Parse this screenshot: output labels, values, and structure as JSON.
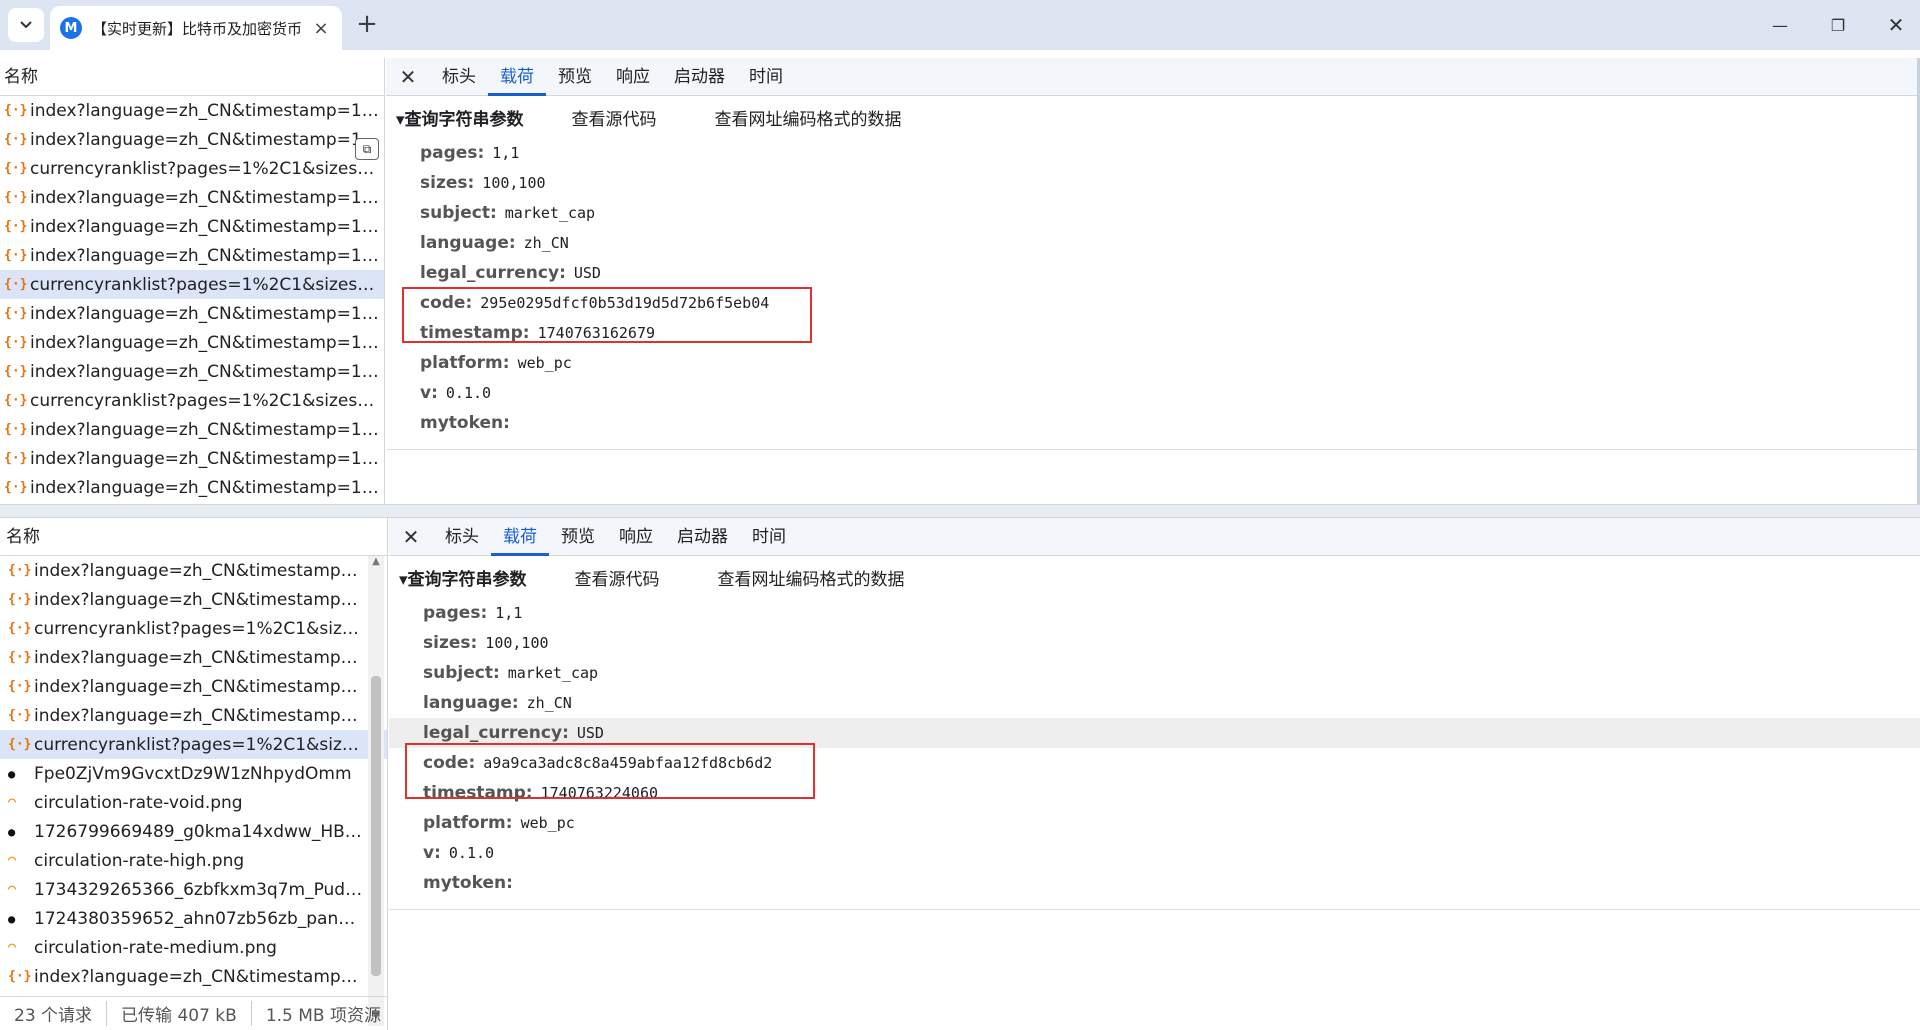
{
  "browser": {
    "tab_title": "【实时更新】比特币及加密货币",
    "tab_close": "×",
    "new_tab": "+",
    "favicon_letter": "M"
  },
  "window_controls": {
    "minimize": "—",
    "maximize": "❐",
    "close": "✕"
  },
  "top": {
    "list_header": "名称",
    "rows": [
      {
        "text": "index?language=zh_CN&timestamp=1740...",
        "icon": "{·}"
      },
      {
        "text": "index?language=zh_CN&timestamp=1...",
        "icon": "{·}"
      },
      {
        "text": "currencyranklist?pages=1%2C1&sizes=10...",
        "icon": "{·}"
      },
      {
        "text": "index?language=zh_CN&timestamp=1740...",
        "icon": "{·}"
      },
      {
        "text": "index?language=zh_CN&timestamp=1740...",
        "icon": "{·}"
      },
      {
        "text": "index?language=zh_CN&timestamp=1740...",
        "icon": "{·}"
      },
      {
        "text": "currencyranklist?pages=1%2C1&sizes=10...",
        "icon": "{·}"
      },
      {
        "text": "index?language=zh_CN&timestamp=1740...",
        "icon": "{·}"
      },
      {
        "text": "index?language=zh_CN&timestamp=1740...",
        "icon": "{·}"
      },
      {
        "text": "index?language=zh_CN&timestamp=1740...",
        "icon": "{·}"
      },
      {
        "text": "currencyranklist?pages=1%2C1&sizes=10...",
        "icon": "{·}"
      },
      {
        "text": "index?language=zh_CN&timestamp=1740...",
        "icon": "{·}"
      },
      {
        "text": "index?language=zh_CN&timestamp=1740...",
        "icon": "{·}"
      },
      {
        "text": "index?language=zh_CN&timestamp=1740...",
        "icon": "{·}"
      }
    ],
    "copy_icon": "⧉",
    "detail_tabs": {
      "close": "✕",
      "headers": "标头",
      "payload": "载荷",
      "preview": "预览",
      "response": "响应",
      "initiator": "启动器",
      "timing": "时间"
    },
    "qs": {
      "title": "▾查询字符串参数",
      "view_source": "查看源代码",
      "view_url_encoded": "查看网址编码格式的数据"
    },
    "params": [
      {
        "key": "pages:",
        "value": "1,1"
      },
      {
        "key": "sizes:",
        "value": "100,100"
      },
      {
        "key": "subject:",
        "value": "market_cap"
      },
      {
        "key": "language:",
        "value": "zh_CN"
      },
      {
        "key": "legal_currency:",
        "value": "USD"
      },
      {
        "key": "code:",
        "value": "295e0295dfcf0b53d19d5d72b6f5eb04"
      },
      {
        "key": "timestamp:",
        "value": "1740763162679"
      },
      {
        "key": "platform:",
        "value": "web_pc"
      },
      {
        "key": "v:",
        "value": "0.1.0"
      },
      {
        "key": "mytoken:",
        "value": ""
      }
    ]
  },
  "bottom": {
    "list_header": "名称",
    "rows": [
      {
        "text": "index?language=zh_CN&timestamp=1...",
        "icon": "{·}"
      },
      {
        "text": "index?language=zh_CN&timestamp=1...",
        "icon": "{·}"
      },
      {
        "text": "currencyranklist?pages=1%2C1&sizes=...",
        "icon": "{·}"
      },
      {
        "text": "index?language=zh_CN&timestamp=1...",
        "icon": "{·}"
      },
      {
        "text": "index?language=zh_CN&timestamp=1...",
        "icon": "{·}"
      },
      {
        "text": "index?language=zh_CN&timestamp=1...",
        "icon": "{·}"
      },
      {
        "text": "currencyranklist?pages=1%2C1&sizes=...",
        "icon": "{·}"
      },
      {
        "text": "Fpe0ZjVm9GvcxtDz9W1zNhpydOmm",
        "icon": "●"
      },
      {
        "text": "circulation-rate-void.png",
        "icon": "◠"
      },
      {
        "text": "1726799669489_g0kma14xdww_HBAR....",
        "icon": "●"
      },
      {
        "text": "circulation-rate-high.png",
        "icon": "◠"
      },
      {
        "text": "1734329265366_6zbfkxm3q7m_Pudgy...",
        "icon": "◠"
      },
      {
        "text": "1724380359652_ahn07zb56zb_pancake...",
        "icon": "●"
      },
      {
        "text": "circulation-rate-medium.png",
        "icon": "◠"
      },
      {
        "text": "index?language=zh_CN&timestamp=1...",
        "icon": "{·}"
      }
    ],
    "status": {
      "requests": "23 个请求",
      "transferred": "已传输 407 kB",
      "resources": "1.5 MB 项资源"
    },
    "scroll_up": "▲",
    "scroll_down": "▼",
    "detail_tabs": {
      "close": "✕",
      "headers": "标头",
      "payload": "载荷",
      "preview": "预览",
      "response": "响应",
      "initiator": "启动器",
      "timing": "时间"
    },
    "qs": {
      "title": "▾查询字符串参数",
      "view_source": "查看源代码",
      "view_url_encoded": "查看网址编码格式的数据"
    },
    "params": [
      {
        "key": "pages:",
        "value": "1,1"
      },
      {
        "key": "sizes:",
        "value": "100,100"
      },
      {
        "key": "subject:",
        "value": "market_cap"
      },
      {
        "key": "language:",
        "value": "zh_CN"
      },
      {
        "key": "legal_currency:",
        "value": "USD"
      },
      {
        "key": "code:",
        "value": "a9a9ca3adc8c8a459abfaa12fd8cb6d2"
      },
      {
        "key": "timestamp:",
        "value": "1740763224060"
      },
      {
        "key": "platform:",
        "value": "web_pc"
      },
      {
        "key": "v:",
        "value": "0.1.0"
      },
      {
        "key": "mytoken:",
        "value": ""
      }
    ]
  },
  "colors": {
    "accent": "#1a5fd0",
    "selected_row": "#dbe5f7",
    "highlight_box": "#e03030"
  }
}
